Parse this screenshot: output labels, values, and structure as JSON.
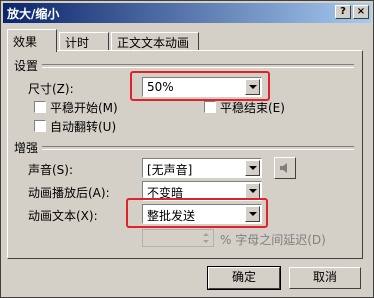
{
  "window": {
    "title": "放大/缩小",
    "help_btn": "?",
    "close_btn": "×"
  },
  "tabs": [
    {
      "label": "效果"
    },
    {
      "label": "计时"
    },
    {
      "label": "正文文本动画"
    }
  ],
  "settings": {
    "group_label": "设置",
    "size_label": "尺寸(Z):",
    "size_value": "50%",
    "smooth_start": "平稳开始(M)",
    "smooth_end": "平稳结束(E)",
    "auto_reverse": "自动翻转(U)"
  },
  "enhance": {
    "group_label": "增强",
    "sound_label": "声音(S):",
    "sound_value": "[无声音]",
    "after_label": "动画播放后(A):",
    "after_value": "不变暗",
    "text_label": "动画文本(X):",
    "text_value": "整批发送",
    "delay_text": "% 字母之间延迟(D)"
  },
  "buttons": {
    "ok": "确定",
    "cancel": "取消"
  },
  "colors": {
    "title_bar": "#0a246a",
    "highlight": "#e0222c",
    "face": "#d4d0c8"
  }
}
